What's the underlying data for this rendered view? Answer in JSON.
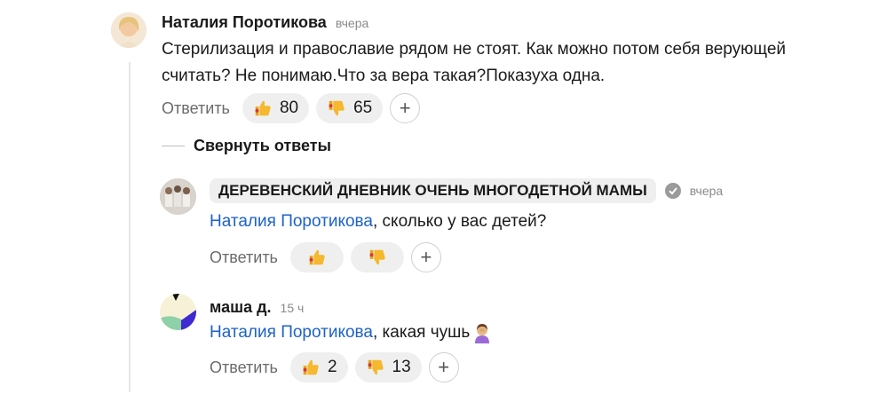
{
  "comments": [
    {
      "author": "Наталия Поротикова",
      "time": "вчера",
      "text_line1": "Стерилизация и православие рядом не стоят. Как можно потом себя верующей",
      "text_line2": "считать? Не понимаю.Что за вера такая?Показуха одна.",
      "reply_label": "Ответить",
      "likes": "80",
      "dislikes": "65"
    }
  ],
  "collapse_label": "Свернуть ответы",
  "replies": [
    {
      "author": "ДЕРЕВЕНСКИЙ ДНЕВНИК ОЧЕНЬ МНОГОДЕТНОЙ МАМЫ",
      "time": "вчера",
      "mention": "Наталия Поротикова",
      "text": ", сколько у вас детей?",
      "reply_label": "Ответить"
    },
    {
      "author": "маша д.",
      "time": "15 ч",
      "mention": "Наталия Поротикова",
      "text": ", какая чушь",
      "reply_label": "Ответить",
      "likes": "2",
      "dislikes": "13"
    }
  ],
  "icons": {
    "like": "thumbs-up-icon",
    "dislike": "thumbs-down-icon",
    "add_reaction": "plus-icon",
    "verified": "verified-icon",
    "emoji": "facepalm-emoji"
  }
}
